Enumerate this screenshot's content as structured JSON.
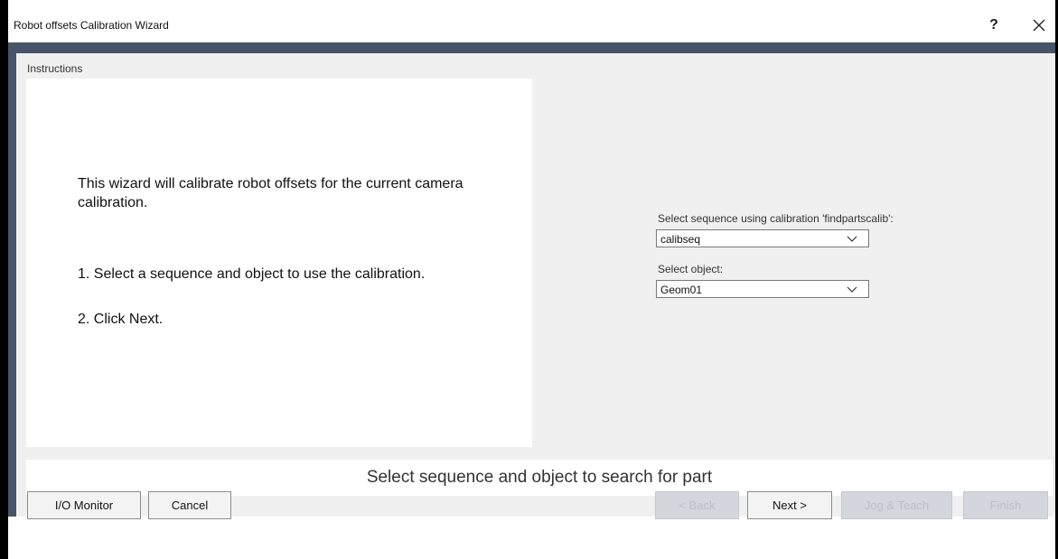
{
  "window": {
    "title": "Robot offsets Calibration Wizard",
    "help_label": "?",
    "close_label": "✕"
  },
  "instructions": {
    "label": "Instructions",
    "text_intro": "This wizard will calibrate robot offsets for the current camera calibration.",
    "step1": "1. Select a sequence and object to use the calibration.",
    "step2": "2. Click Next."
  },
  "sequence": {
    "label": "Select sequence using calibration 'findpartscalib':",
    "value": "calibseq"
  },
  "object": {
    "label": "Select object:",
    "value": "Geom01"
  },
  "status": {
    "text": "Select sequence and object to search for part"
  },
  "buttons": {
    "io_monitor": "I/O Monitor",
    "cancel": "Cancel",
    "back": "< Back",
    "next": "Next >",
    "jog_teach": "Jog & Teach",
    "finish": "Finish"
  },
  "colors": {
    "frame_dark": "#485469",
    "panel": "#f0f0f0",
    "disabled_button": "#d3d6dc"
  }
}
